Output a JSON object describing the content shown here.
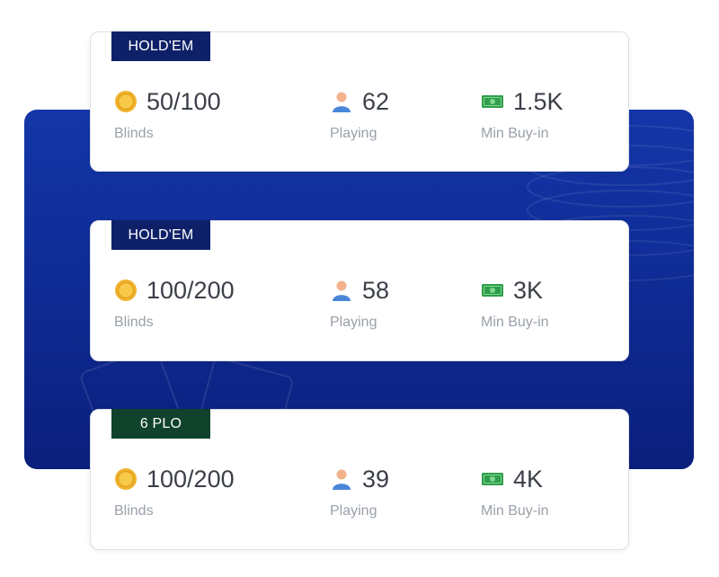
{
  "tables": [
    {
      "game": "HOLD'EM",
      "badge_color": "#0e2168",
      "blinds": "50/100",
      "players": "62",
      "min_buyin": "1.5K"
    },
    {
      "game": "HOLD'EM",
      "badge_color": "#0e2168",
      "blinds": "100/200",
      "players": "58",
      "min_buyin": "3K"
    },
    {
      "game": "6 PLO",
      "badge_color": "#10422c",
      "blinds": "100/200",
      "players": "39",
      "min_buyin": "4K"
    }
  ],
  "labels": {
    "blinds": "Blinds",
    "players": "Playing",
    "min_buyin": "Min Buy-in"
  },
  "icons": {
    "blinds": "gold-coin-icon",
    "players": "person-icon",
    "min_buyin": "cash-icon"
  },
  "colors": {
    "panel_background": "#1236a6",
    "holdem_badge": "#0e2168",
    "plo_badge": "#10422c",
    "coin": "#f0b22e",
    "cash": "#2f9e4a"
  }
}
